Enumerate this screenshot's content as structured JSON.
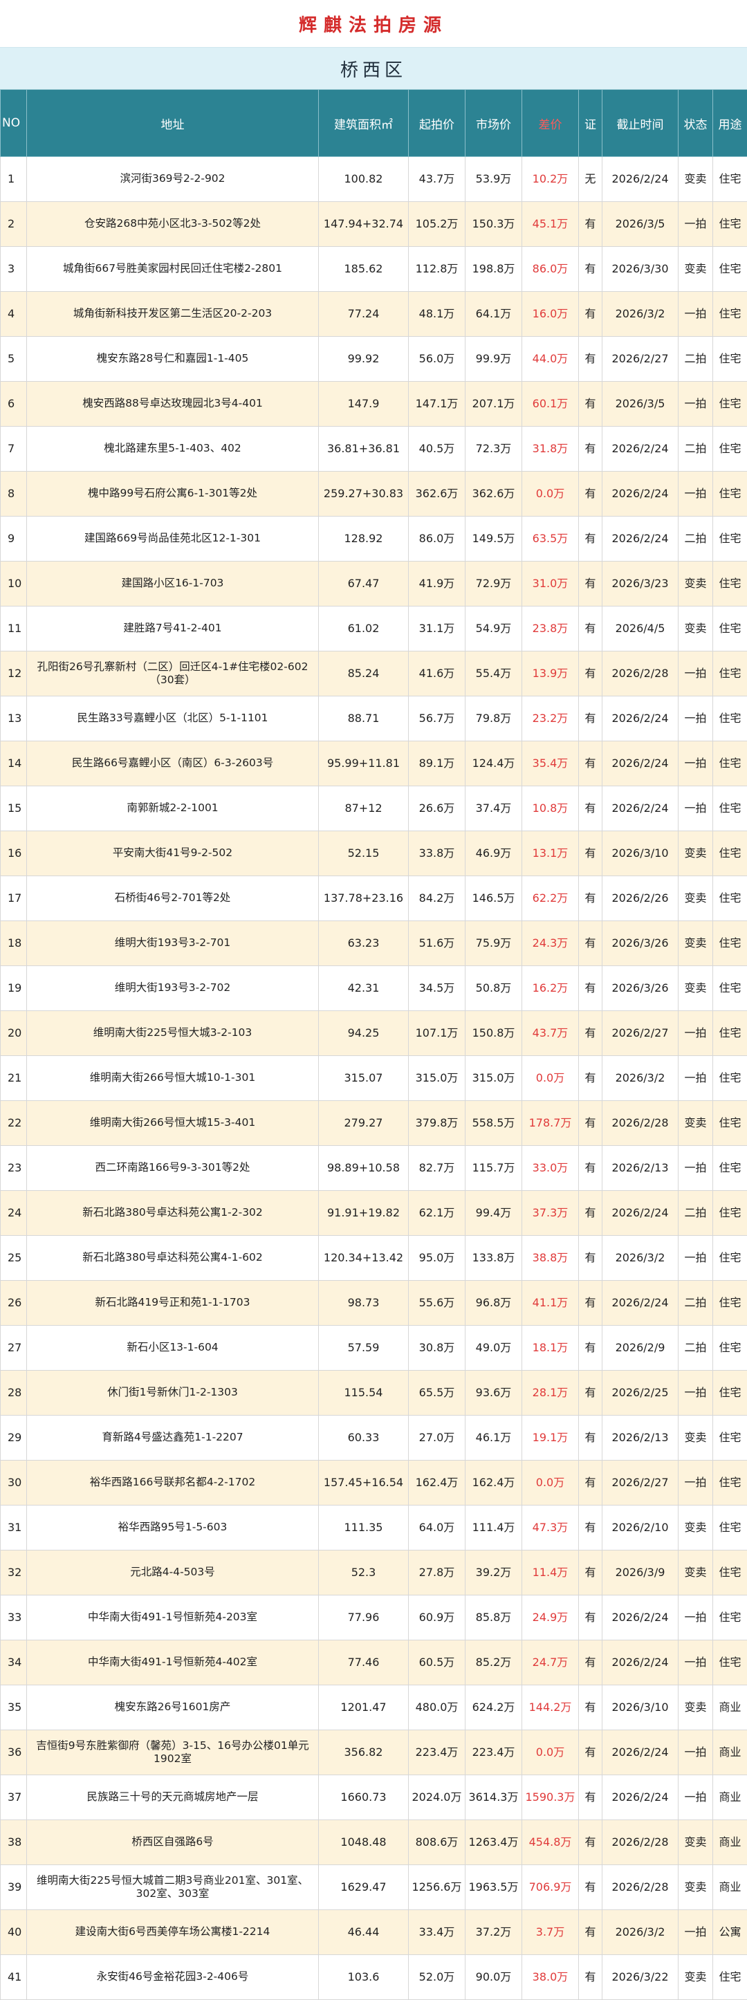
{
  "header": {
    "title": "辉麒法拍房源",
    "district": "桥西区"
  },
  "table": {
    "columns": [
      "NO",
      "地址",
      "建筑面积㎡",
      "起拍价",
      "市场价",
      "差价",
      "证",
      "截止时间",
      "状态",
      "用途"
    ],
    "rows": [
      [
        "1",
        "滨河街369号2-2-902",
        "100.82",
        "43.7万",
        "53.9万",
        "10.2万",
        "无",
        "2026/2/24",
        "变卖",
        "住宅"
      ],
      [
        "2",
        "仓安路268中苑小区北3-3-502等2处",
        "147.94+32.74",
        "105.2万",
        "150.3万",
        "45.1万",
        "有",
        "2026/3/5",
        "一拍",
        "住宅"
      ],
      [
        "3",
        "城角街667号胜美家园村民回迁住宅楼2-2801",
        "185.62",
        "112.8万",
        "198.8万",
        "86.0万",
        "有",
        "2026/3/30",
        "变卖",
        "住宅"
      ],
      [
        "4",
        "城角街新科技开发区第二生活区20-2-203",
        "77.24",
        "48.1万",
        "64.1万",
        "16.0万",
        "有",
        "2026/3/2",
        "一拍",
        "住宅"
      ],
      [
        "5",
        "槐安东路28号仁和嘉园1-1-405",
        "99.92",
        "56.0万",
        "99.9万",
        "44.0万",
        "有",
        "2026/2/27",
        "二拍",
        "住宅"
      ],
      [
        "6",
        "槐安西路88号卓达玫瑰园北3号4-401",
        "147.9",
        "147.1万",
        "207.1万",
        "60.1万",
        "有",
        "2026/3/5",
        "一拍",
        "住宅"
      ],
      [
        "7",
        "槐北路建东里5-1-403、402",
        "36.81+36.81",
        "40.5万",
        "72.3万",
        "31.8万",
        "有",
        "2026/2/24",
        "二拍",
        "住宅"
      ],
      [
        "8",
        "槐中路99号石府公寓6-1-301等2处",
        "259.27+30.83",
        "362.6万",
        "362.6万",
        "0.0万",
        "有",
        "2026/2/24",
        "一拍",
        "住宅"
      ],
      [
        "9",
        "建国路669号尚品佳苑北区12-1-301",
        "128.92",
        "86.0万",
        "149.5万",
        "63.5万",
        "有",
        "2026/2/24",
        "二拍",
        "住宅"
      ],
      [
        "10",
        "建国路小区16-1-703",
        "67.47",
        "41.9万",
        "72.9万",
        "31.0万",
        "有",
        "2026/3/23",
        "变卖",
        "住宅"
      ],
      [
        "11",
        "建胜路7号41-2-401",
        "61.02",
        "31.1万",
        "54.9万",
        "23.8万",
        "有",
        "2026/4/5",
        "变卖",
        "住宅"
      ],
      [
        "12",
        "孔阳街26号孔寨新村（二区）回迁区4-1#住宅楼02-602（30套）",
        "85.24",
        "41.6万",
        "55.4万",
        "13.9万",
        "有",
        "2026/2/28",
        "一拍",
        "住宅"
      ],
      [
        "13",
        "民生路33号嘉鲤小区（北区）5-1-1101",
        "88.71",
        "56.7万",
        "79.8万",
        "23.2万",
        "有",
        "2026/2/24",
        "一拍",
        "住宅"
      ],
      [
        "14",
        "民生路66号嘉鲤小区（南区）6-3-2603号",
        "95.99+11.81",
        "89.1万",
        "124.4万",
        "35.4万",
        "有",
        "2026/2/24",
        "一拍",
        "住宅"
      ],
      [
        "15",
        "南郭新城2-2-1001",
        "87+12",
        "26.6万",
        "37.4万",
        "10.8万",
        "有",
        "2026/2/24",
        "一拍",
        "住宅"
      ],
      [
        "16",
        "平安南大街41号9-2-502",
        "52.15",
        "33.8万",
        "46.9万",
        "13.1万",
        "有",
        "2026/3/10",
        "变卖",
        "住宅"
      ],
      [
        "17",
        "石桥街46号2-701等2处",
        "137.78+23.16",
        "84.2万",
        "146.5万",
        "62.2万",
        "有",
        "2026/2/26",
        "变卖",
        "住宅"
      ],
      [
        "18",
        "维明大街193号3-2-701",
        "63.23",
        "51.6万",
        "75.9万",
        "24.3万",
        "有",
        "2026/3/26",
        "变卖",
        "住宅"
      ],
      [
        "19",
        "维明大街193号3-2-702",
        "42.31",
        "34.5万",
        "50.8万",
        "16.2万",
        "有",
        "2026/3/26",
        "变卖",
        "住宅"
      ],
      [
        "20",
        "维明南大街225号恒大城3-2-103",
        "94.25",
        "107.1万",
        "150.8万",
        "43.7万",
        "有",
        "2026/2/27",
        "一拍",
        "住宅"
      ],
      [
        "21",
        "维明南大街266号恒大城10-1-301",
        "315.07",
        "315.0万",
        "315.0万",
        "0.0万",
        "有",
        "2026/3/2",
        "一拍",
        "住宅"
      ],
      [
        "22",
        "维明南大街266号恒大城15-3-401",
        "279.27",
        "379.8万",
        "558.5万",
        "178.7万",
        "有",
        "2026/2/28",
        "变卖",
        "住宅"
      ],
      [
        "23",
        "西二环南路166号9-3-301等2处",
        "98.89+10.58",
        "82.7万",
        "115.7万",
        "33.0万",
        "有",
        "2026/2/13",
        "一拍",
        "住宅"
      ],
      [
        "24",
        "新石北路380号卓达科苑公寓1-2-302",
        "91.91+19.82",
        "62.1万",
        "99.4万",
        "37.3万",
        "有",
        "2026/2/24",
        "二拍",
        "住宅"
      ],
      [
        "25",
        "新石北路380号卓达科苑公寓4-1-602",
        "120.34+13.42",
        "95.0万",
        "133.8万",
        "38.8万",
        "有",
        "2026/3/2",
        "一拍",
        "住宅"
      ],
      [
        "26",
        "新石北路419号正和苑1-1-1703",
        "98.73",
        "55.6万",
        "96.8万",
        "41.1万",
        "有",
        "2026/2/24",
        "二拍",
        "住宅"
      ],
      [
        "27",
        "新石小区13-1-604",
        "57.59",
        "30.8万",
        "49.0万",
        "18.1万",
        "有",
        "2026/2/9",
        "二拍",
        "住宅"
      ],
      [
        "28",
        "休门街1号新休门1-2-1303",
        "115.54",
        "65.5万",
        "93.6万",
        "28.1万",
        "有",
        "2026/2/25",
        "一拍",
        "住宅"
      ],
      [
        "29",
        "育新路4号盛达鑫苑1-1-2207",
        "60.33",
        "27.0万",
        "46.1万",
        "19.1万",
        "有",
        "2026/2/13",
        "变卖",
        "住宅"
      ],
      [
        "30",
        "裕华西路166号联邦名都4-2-1702",
        "157.45+16.54",
        "162.4万",
        "162.4万",
        "0.0万",
        "有",
        "2026/2/27",
        "一拍",
        "住宅"
      ],
      [
        "31",
        "裕华西路95号1-5-603",
        "111.35",
        "64.0万",
        "111.4万",
        "47.3万",
        "有",
        "2026/2/10",
        "变卖",
        "住宅"
      ],
      [
        "32",
        "元北路4-4-503号",
        "52.3",
        "27.8万",
        "39.2万",
        "11.4万",
        "有",
        "2026/3/9",
        "变卖",
        "住宅"
      ],
      [
        "33",
        "中华南大街491-1号恒新苑4-203室",
        "77.96",
        "60.9万",
        "85.8万",
        "24.9万",
        "有",
        "2026/2/24",
        "一拍",
        "住宅"
      ],
      [
        "34",
        "中华南大街491-1号恒新苑4-402室",
        "77.46",
        "60.5万",
        "85.2万",
        "24.7万",
        "有",
        "2026/2/24",
        "一拍",
        "住宅"
      ],
      [
        "35",
        "槐安东路26号1601房产",
        "1201.47",
        "480.0万",
        "624.2万",
        "144.2万",
        "有",
        "2026/3/10",
        "变卖",
        "商业"
      ],
      [
        "36",
        "吉恒街9号东胜紫御府（馨苑）3-15、16号办公楼01单元1902室",
        "356.82",
        "223.4万",
        "223.4万",
        "0.0万",
        "有",
        "2026/2/24",
        "一拍",
        "商业"
      ],
      [
        "37",
        "民族路三十号的天元商城房地产一层",
        "1660.73",
        "2024.0万",
        "3614.3万",
        "1590.3万",
        "有",
        "2026/2/24",
        "一拍",
        "商业"
      ],
      [
        "38",
        "桥西区自强路6号",
        "1048.48",
        "808.6万",
        "1263.4万",
        "454.8万",
        "有",
        "2026/2/28",
        "变卖",
        "商业"
      ],
      [
        "39",
        "维明南大街225号恒大城首二期3号商业201室、301室、302室、303室",
        "1629.47",
        "1256.6万",
        "1963.5万",
        "706.9万",
        "有",
        "2026/2/28",
        "变卖",
        "商业"
      ],
      [
        "40",
        "建设南大街6号西美停车场公寓楼1-2214",
        "46.44",
        "33.4万",
        "37.2万",
        "3.7万",
        "有",
        "2026/3/2",
        "一拍",
        "公寓"
      ],
      [
        "41",
        "永安街46号金裕花园3-2-406号",
        "103.6",
        "52.0万",
        "90.0万",
        "38.0万",
        "有",
        "2026/3/22",
        "变卖",
        "住宅"
      ]
    ]
  }
}
